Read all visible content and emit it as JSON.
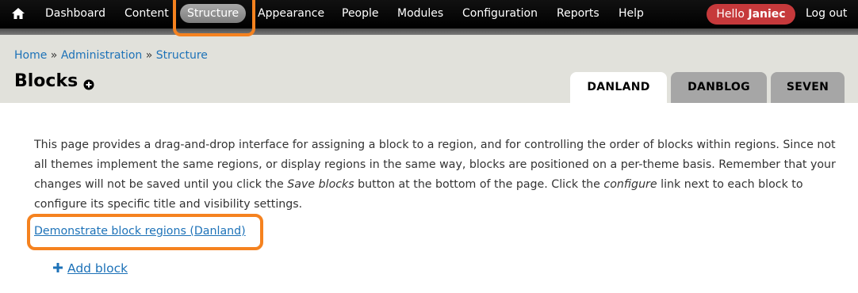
{
  "toolbar": {
    "items": [
      {
        "label": "Dashboard"
      },
      {
        "label": "Content"
      },
      {
        "label": "Structure"
      },
      {
        "label": "Appearance"
      },
      {
        "label": "People"
      },
      {
        "label": "Modules"
      },
      {
        "label": "Configuration"
      },
      {
        "label": "Reports"
      },
      {
        "label": "Help"
      }
    ],
    "hello_prefix": "Hello",
    "user": "Janiec",
    "logout": "Log out",
    "home_icon": "home-icon",
    "hello_color": "#c6393b"
  },
  "breadcrumb": {
    "items": [
      "Home",
      "Administration",
      "Structure"
    ],
    "separator": "»"
  },
  "page": {
    "title": "Blocks",
    "add_shortcut_icon": "plus-circle-icon"
  },
  "tabs": [
    {
      "label": "DANLAND",
      "active": true
    },
    {
      "label": "DANBLOG",
      "active": false
    },
    {
      "label": "SEVEN",
      "active": false
    }
  ],
  "content": {
    "desc_part1": "This page provides a drag-and-drop interface for assigning a block to a region, and for controlling the order of blocks within regions. Since not all themes implement the same regions, or display regions in the same way, blocks are positioned on a per-theme basis. Remember that your changes will not be saved until you click the ",
    "desc_em1": "Save blocks",
    "desc_part2": " button at the bottom of the page. Click the ",
    "desc_em2": "configure",
    "desc_part3": " link next to each block to configure its specific title and visibility settings.",
    "demo_link": "Demonstrate block regions (Danland)",
    "add_block": "Add block",
    "add_block_icon": "plus-icon"
  },
  "colors": {
    "link": "#1d72b8",
    "highlight": "#f5821f"
  }
}
